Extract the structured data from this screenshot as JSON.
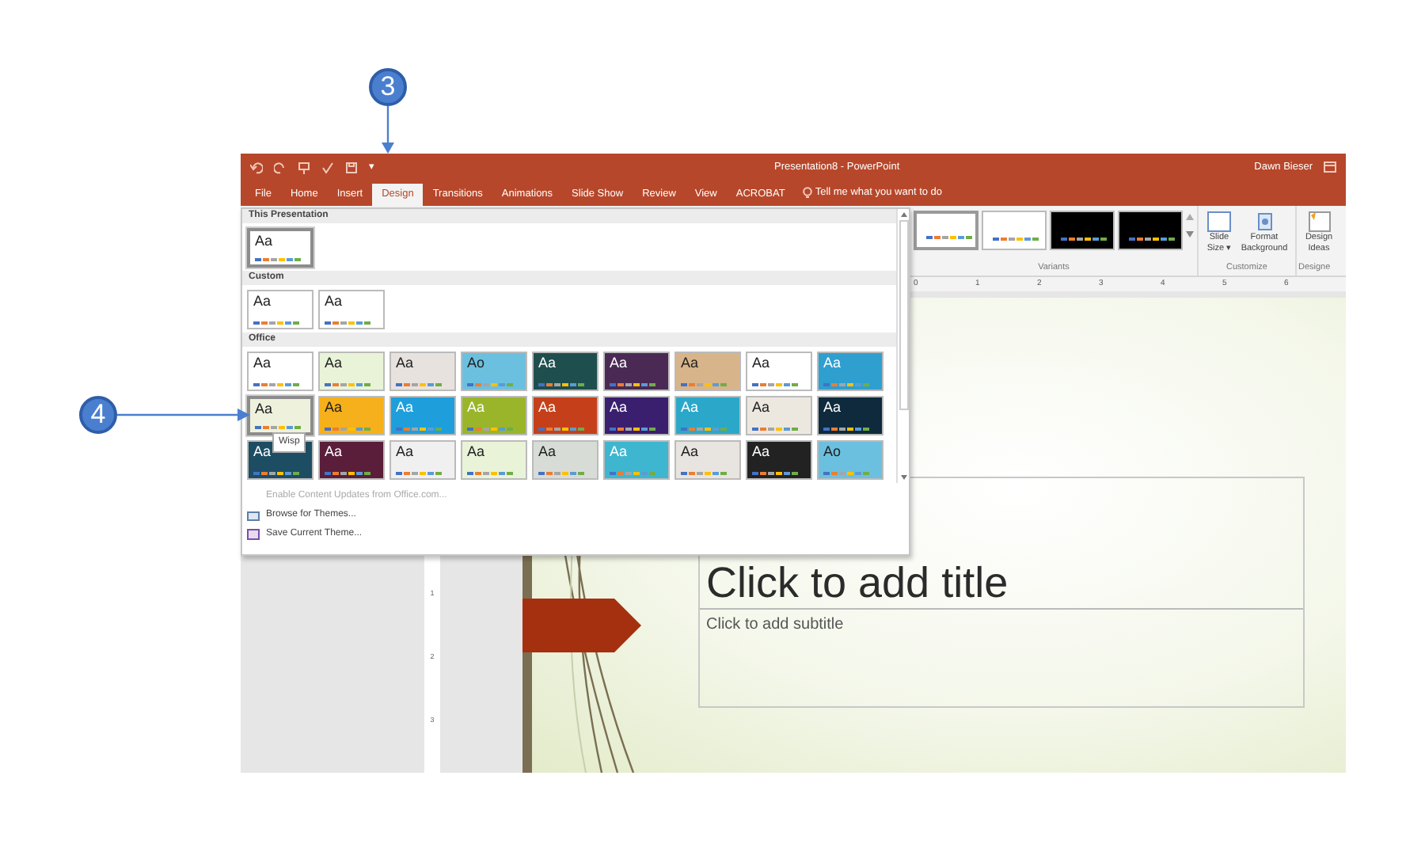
{
  "callouts": [
    {
      "label": "3"
    },
    {
      "label": "4"
    }
  ],
  "window": {
    "title": "Presentation8 - PowerPoint",
    "user": "Dawn Bieser",
    "quick_access_more": "▾"
  },
  "tabs": [
    {
      "label": "File",
      "selected": false
    },
    {
      "label": "Home",
      "selected": false
    },
    {
      "label": "Insert",
      "selected": false
    },
    {
      "label": "Design",
      "selected": true
    },
    {
      "label": "Transitions",
      "selected": false
    },
    {
      "label": "Animations",
      "selected": false
    },
    {
      "label": "Slide Show",
      "selected": false
    },
    {
      "label": "Review",
      "selected": false
    },
    {
      "label": "View",
      "selected": false
    },
    {
      "label": "ACROBAT",
      "selected": false
    }
  ],
  "tell_me": "Tell me what you want to do",
  "variants": {
    "label": "Variants",
    "items": [
      {
        "dark": false,
        "selected": true
      },
      {
        "dark": false,
        "selected": false
      },
      {
        "dark": true,
        "selected": false
      },
      {
        "dark": true,
        "selected": false
      }
    ]
  },
  "customize": {
    "label": "Customize",
    "buttons": [
      {
        "label": "Slide Size",
        "caret": "▾"
      },
      {
        "label": "Format Background"
      }
    ]
  },
  "designer": {
    "label": "Designe",
    "buttons": [
      {
        "label": "Design Ideas"
      }
    ]
  },
  "ruler": {
    "horizontal": [
      "0",
      "1",
      "2",
      "3",
      "4",
      "5",
      "6"
    ],
    "vertical": [
      "1",
      "2",
      "3"
    ]
  },
  "gallery": {
    "sections": [
      {
        "title": "This Presentation",
        "themes": [
          {
            "sample": "Aa",
            "color": "#ffffff",
            "dark": false,
            "selected": true
          }
        ]
      },
      {
        "title": "Custom",
        "themes": [
          {
            "sample": "Aa",
            "color": "#ffffff",
            "dark": false,
            "selected": false
          },
          {
            "sample": "Aa",
            "color": "#ffffff",
            "dark": false,
            "selected": false
          }
        ]
      },
      {
        "title": "Office",
        "themes": [
          {
            "sample": "Aa",
            "color": "#ffffff",
            "dark": false,
            "selected": false
          },
          {
            "sample": "Aa",
            "color": "#e9f3d8",
            "dark": false,
            "selected": false
          },
          {
            "sample": "Aa",
            "color": "#e8e2de",
            "dark": false,
            "selected": false
          },
          {
            "sample": "Ao",
            "color": "#6cc0df",
            "dark": false,
            "selected": false
          },
          {
            "sample": "Aa",
            "color": "#1f4e4f",
            "dark": true,
            "selected": false
          },
          {
            "sample": "Aa",
            "color": "#4a2a55",
            "dark": true,
            "selected": false
          },
          {
            "sample": "Aa",
            "color": "#d8b48a",
            "dark": false,
            "selected": false
          },
          {
            "sample": "Aa",
            "color": "#ffffff",
            "dark": false,
            "selected": false
          },
          {
            "sample": "Aa",
            "color": "#2f9fd0",
            "dark": true,
            "selected": false
          },
          {
            "sample": "Aa",
            "color": "#eef2dc",
            "dark": false,
            "selected": true
          },
          {
            "sample": "Aa",
            "color": "#f5b01b",
            "dark": false,
            "selected": false
          },
          {
            "sample": "Aa",
            "color": "#1e9fdc",
            "dark": true,
            "selected": false
          },
          {
            "sample": "Aa",
            "color": "#9bb52a",
            "dark": true,
            "selected": false
          },
          {
            "sample": "Aa",
            "color": "#c5401a",
            "dark": true,
            "selected": false
          },
          {
            "sample": "Aa",
            "color": "#3a1f6e",
            "dark": true,
            "selected": false
          },
          {
            "sample": "Aa",
            "color": "#2ba8c9",
            "dark": true,
            "selected": false
          },
          {
            "sample": "Aa",
            "color": "#ece8e0",
            "dark": false,
            "selected": false
          },
          {
            "sample": "Aa",
            "color": "#0f2a3d",
            "dark": true,
            "selected": false
          },
          {
            "sample": "Aa",
            "color": "#1d4d63",
            "dark": true,
            "selected": false
          },
          {
            "sample": "Aa",
            "color": "#5a1e3a",
            "dark": true,
            "selected": false
          },
          {
            "sample": "Aa",
            "color": "#f0f0f0",
            "dark": false,
            "selected": false
          },
          {
            "sample": "Aa",
            "color": "#e9f3d8",
            "dark": false,
            "selected": false
          },
          {
            "sample": "Aa",
            "color": "#d8dcd6",
            "dark": false,
            "selected": false
          },
          {
            "sample": "Aa",
            "color": "#3fb6d0",
            "dark": true,
            "selected": false
          },
          {
            "sample": "Aa",
            "color": "#e8e4df",
            "dark": false,
            "selected": false
          },
          {
            "sample": "Aa",
            "color": "#222222",
            "dark": true,
            "selected": false
          },
          {
            "sample": "Ao",
            "color": "#6cc0df",
            "dark": false,
            "selected": false
          }
        ]
      }
    ],
    "tooltip": "Wisp",
    "menu": [
      {
        "label": "Enable Content Updates from Office.com...",
        "disabled": true,
        "kind": "plain"
      },
      {
        "label": "Browse for Themes...",
        "disabled": false,
        "kind": "browse"
      },
      {
        "label": "Save Current Theme...",
        "disabled": false,
        "kind": "save"
      }
    ]
  },
  "slide": {
    "title": "Click to add title",
    "subtitle": "Click to add subtitle"
  }
}
